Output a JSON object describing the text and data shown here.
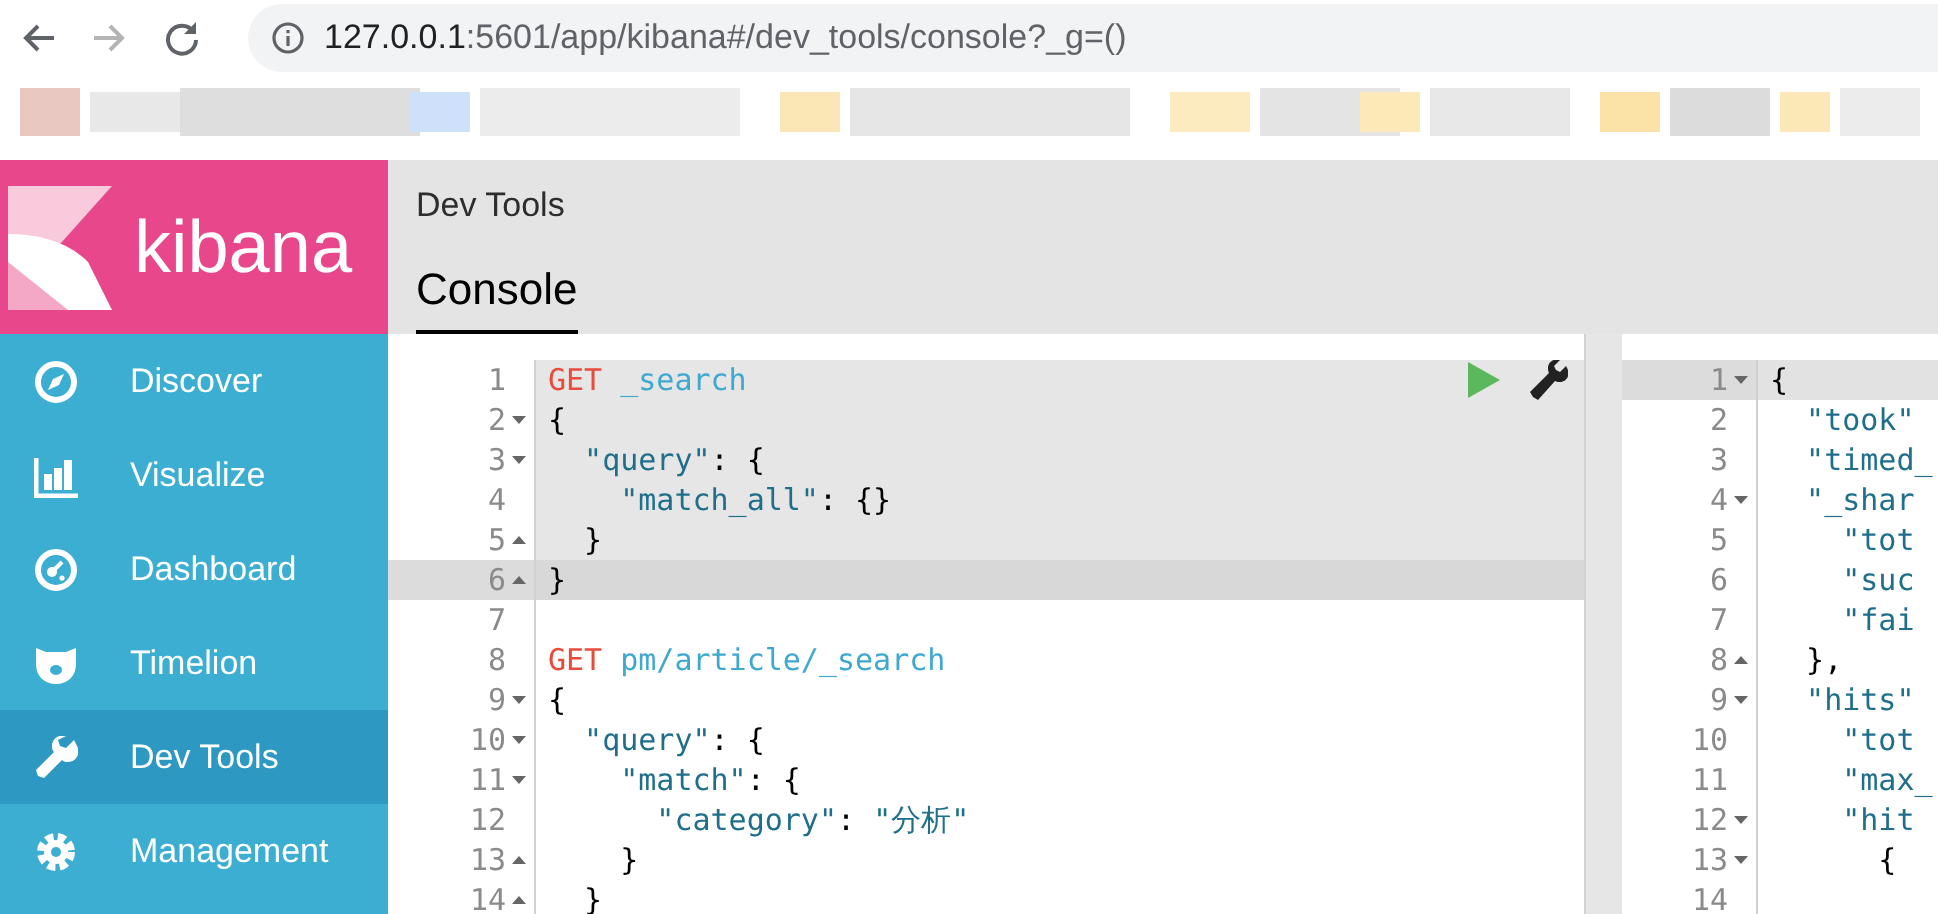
{
  "browser": {
    "nav_buttons": [
      {
        "kind": "back",
        "disabled": false
      },
      {
        "kind": "forward",
        "disabled": true
      },
      {
        "kind": "reload",
        "disabled": false
      }
    ],
    "address": {
      "host": "127.0.0.1",
      "path": ":5601/app/kibana#/dev_tools/console?_g=()"
    }
  },
  "sidebar": {
    "logo": "kibana",
    "items": [
      {
        "label": "Discover",
        "selected": false
      },
      {
        "label": "Visualize",
        "selected": false
      },
      {
        "label": "Dashboard",
        "selected": false
      },
      {
        "label": "Timelion",
        "selected": false
      },
      {
        "label": "Dev Tools",
        "selected": true
      },
      {
        "label": "Management",
        "selected": false
      }
    ]
  },
  "header": {
    "title": "Dev Tools",
    "tabs": [
      {
        "label": "Console",
        "selected": true
      }
    ]
  },
  "request_editor": {
    "lines": [
      {
        "number": "1",
        "fold_start": false,
        "fold_end": false,
        "in_request": true,
        "active": false,
        "tokens": [
          {
            "t": "GET",
            "kind": "method"
          },
          {
            "t": " _search",
            "kind": "url"
          }
        ]
      },
      {
        "number": "2",
        "fold_start": true,
        "fold_end": false,
        "in_request": true,
        "active": false,
        "tokens": [
          {
            "t": "{",
            "kind": "punct"
          }
        ]
      },
      {
        "number": "3",
        "fold_start": true,
        "fold_end": false,
        "in_request": true,
        "active": false,
        "tokens": [
          {
            "t": "  \"query\"",
            "kind": "key"
          },
          {
            "t": ": {",
            "kind": "punct"
          }
        ]
      },
      {
        "number": "4",
        "fold_start": false,
        "fold_end": false,
        "in_request": true,
        "active": false,
        "tokens": [
          {
            "t": "    \"match_all\"",
            "kind": "key"
          },
          {
            "t": ": {}",
            "kind": "punct"
          }
        ]
      },
      {
        "number": "5",
        "fold_start": false,
        "fold_end": true,
        "in_request": true,
        "active": false,
        "tokens": [
          {
            "t": "  }",
            "kind": "punct"
          }
        ]
      },
      {
        "number": "6",
        "fold_start": false,
        "fold_end": true,
        "in_request": true,
        "active": true,
        "tokens": [
          {
            "t": "}",
            "kind": "punct"
          }
        ]
      },
      {
        "number": "7",
        "fold_start": false,
        "fold_end": false,
        "in_request": false,
        "active": false
      },
      {
        "number": "8",
        "fold_start": false,
        "fold_end": false,
        "in_request": false,
        "active": false,
        "tokens": [
          {
            "t": "GET",
            "kind": "method"
          },
          {
            "t": " pm/article/_search",
            "kind": "url"
          }
        ]
      },
      {
        "number": "9",
        "fold_start": true,
        "fold_end": false,
        "in_request": false,
        "active": false,
        "tokens": [
          {
            "t": "{",
            "kind": "punct"
          }
        ]
      },
      {
        "number": "10",
        "fold_start": true,
        "fold_end": false,
        "in_request": false,
        "active": false,
        "tokens": [
          {
            "t": "  \"query\"",
            "kind": "key"
          },
          {
            "t": ": {",
            "kind": "punct"
          }
        ]
      },
      {
        "number": "11",
        "fold_start": true,
        "fold_end": false,
        "in_request": false,
        "active": false,
        "tokens": [
          {
            "t": "    \"match\"",
            "kind": "key"
          },
          {
            "t": ": {",
            "kind": "punct"
          }
        ]
      },
      {
        "number": "12",
        "fold_start": false,
        "fold_end": false,
        "in_request": false,
        "active": false,
        "tokens": [
          {
            "t": "      \"category\"",
            "kind": "key"
          },
          {
            "t": ": ",
            "kind": "punct"
          },
          {
            "t": "\"分析\"",
            "kind": "string"
          }
        ]
      },
      {
        "number": "13",
        "fold_start": false,
        "fold_end": true,
        "in_request": false,
        "active": false,
        "tokens": [
          {
            "t": "    }",
            "kind": "punct"
          }
        ]
      },
      {
        "number": "14",
        "fold_start": false,
        "fold_end": true,
        "in_request": false,
        "active": false,
        "tokens": [
          {
            "t": "  }",
            "kind": "punct"
          }
        ]
      }
    ]
  },
  "response_editor": {
    "lines": [
      {
        "number": "1",
        "fold_start": true,
        "fold_end": false,
        "active": true,
        "tokens": [
          {
            "t": "{",
            "kind": "punct"
          }
        ]
      },
      {
        "number": "2",
        "fold_start": false,
        "fold_end": false,
        "active": false,
        "tokens": [
          {
            "t": "  \"took\"",
            "kind": "key"
          }
        ]
      },
      {
        "number": "3",
        "fold_start": false,
        "fold_end": false,
        "active": false,
        "tokens": [
          {
            "t": "  \"timed_",
            "kind": "key"
          }
        ]
      },
      {
        "number": "4",
        "fold_start": true,
        "fold_end": false,
        "active": false,
        "tokens": [
          {
            "t": "  \"_shar",
            "kind": "key"
          }
        ]
      },
      {
        "number": "5",
        "fold_start": false,
        "fold_end": false,
        "active": false,
        "tokens": [
          {
            "t": "    \"tot",
            "kind": "key"
          }
        ]
      },
      {
        "number": "6",
        "fold_start": false,
        "fold_end": false,
        "active": false,
        "tokens": [
          {
            "t": "    \"suc",
            "kind": "key"
          }
        ]
      },
      {
        "number": "7",
        "fold_start": false,
        "fold_end": false,
        "active": false,
        "tokens": [
          {
            "t": "    \"fai",
            "kind": "key"
          }
        ]
      },
      {
        "number": "8",
        "fold_start": false,
        "fold_end": true,
        "active": false,
        "tokens": [
          {
            "t": "  },",
            "kind": "punct"
          }
        ]
      },
      {
        "number": "9",
        "fold_start": true,
        "fold_end": false,
        "active": false,
        "tokens": [
          {
            "t": "  \"hits\"",
            "kind": "key"
          }
        ]
      },
      {
        "number": "10",
        "fold_start": false,
        "fold_end": false,
        "active": false,
        "tokens": [
          {
            "t": "    \"tot",
            "kind": "key"
          }
        ]
      },
      {
        "number": "11",
        "fold_start": false,
        "fold_end": false,
        "active": false,
        "tokens": [
          {
            "t": "    \"max_",
            "kind": "key"
          }
        ]
      },
      {
        "number": "12",
        "fold_start": true,
        "fold_end": false,
        "active": false,
        "tokens": [
          {
            "t": "    \"hit",
            "kind": "key"
          }
        ]
      },
      {
        "number": "13",
        "fold_start": true,
        "fold_end": false,
        "active": false,
        "tokens": [
          {
            "t": "      {",
            "kind": "punct"
          }
        ]
      },
      {
        "number": "14",
        "fold_start": false,
        "fold_end": false,
        "active": false
      }
    ]
  }
}
